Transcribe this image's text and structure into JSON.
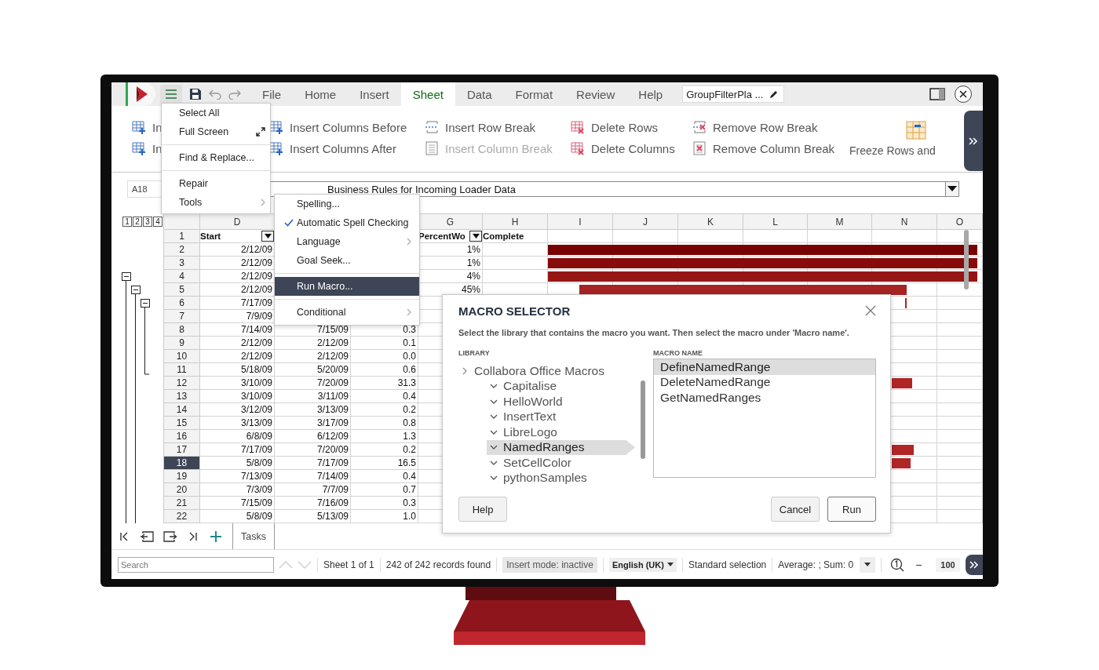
{
  "app": {
    "tabs": [
      {
        "label": "File",
        "selected": false
      },
      {
        "label": "Home",
        "selected": false
      },
      {
        "label": "Insert",
        "selected": false
      },
      {
        "label": "Sheet",
        "selected": true
      },
      {
        "label": "Data",
        "selected": false
      },
      {
        "label": "Format",
        "selected": false
      },
      {
        "label": "Review",
        "selected": false
      },
      {
        "label": "Help",
        "selected": false
      }
    ],
    "document_name": "GroupFilterPla ..."
  },
  "ribbon": {
    "groups": [
      [
        {
          "kind": "rows-above",
          "label": "In",
          "disabled": false
        },
        {
          "kind": "rows-below",
          "label": "In",
          "disabled": false
        }
      ],
      [
        {
          "kind": "cols-before",
          "label": "Insert Columns Before",
          "disabled": false
        },
        {
          "kind": "cols-after",
          "label": "Insert Columns After",
          "disabled": false
        }
      ],
      [
        {
          "kind": "row-break",
          "label": "Insert Row Break",
          "disabled": false
        },
        {
          "kind": "col-break",
          "label": "Insert Column Break",
          "disabled": true
        }
      ],
      [
        {
          "kind": "delete-rows",
          "label": "Delete Rows",
          "disabled": false
        },
        {
          "kind": "delete-cols",
          "label": "Delete Columns",
          "disabled": false
        }
      ],
      [
        {
          "kind": "remove-row-break",
          "label": "Remove Row Break",
          "disabled": false
        },
        {
          "kind": "remove-col-break",
          "label": "Remove Column Break",
          "disabled": false
        }
      ]
    ],
    "large": {
      "label": "Freeze Rows and"
    }
  },
  "formula_bar": {
    "cell": "A18",
    "content": "Business Rules for Incoming Loader Data"
  },
  "sheet": {
    "outline_levels": [
      "1",
      "2",
      "3",
      "4"
    ],
    "columns": [
      {
        "label": "D"
      },
      {},
      {},
      {
        "label": "G"
      },
      {
        "label": "H"
      },
      {
        "label": "I"
      },
      {
        "label": "J"
      },
      {
        "label": "K"
      },
      {
        "label": "L"
      },
      {
        "label": "M"
      },
      {
        "label": "N"
      },
      {
        "label": "O"
      }
    ],
    "header_row": {
      "number": "1",
      "selected": false,
      "cells": [
        {
          "text": "Start",
          "filter": true
        },
        null,
        null,
        {
          "text": "PercentWo",
          "filter": true
        },
        {
          "text": "Complete",
          "filter": false
        }
      ]
    },
    "rows": [
      {
        "number": "2",
        "selected": false,
        "cells": [
          "2/12/09",
          null,
          null,
          "1%",
          null
        ]
      },
      {
        "number": "3",
        "selected": false,
        "cells": [
          "2/12/09",
          null,
          null,
          "1%",
          null
        ]
      },
      {
        "number": "4",
        "selected": false,
        "cells": [
          "2/12/09",
          null,
          null,
          "4%",
          null
        ]
      },
      {
        "number": "5",
        "selected": false,
        "cells": [
          "2/12/09",
          null,
          null,
          "45%",
          null
        ]
      },
      {
        "number": "6",
        "selected": false,
        "cells": [
          "7/17/09",
          null,
          null,
          null,
          null
        ]
      },
      {
        "number": "7",
        "selected": false,
        "cells": [
          "7/9/09",
          null,
          null,
          null,
          null
        ]
      },
      {
        "number": "8",
        "selected": false,
        "cells": [
          "7/14/09",
          "7/15/09",
          "0.3",
          null,
          null
        ]
      },
      {
        "number": "9",
        "selected": false,
        "cells": [
          "2/12/09",
          "2/12/09",
          "0.1",
          null,
          null
        ]
      },
      {
        "number": "10",
        "selected": false,
        "cells": [
          "2/12/09",
          "2/12/09",
          "0.0",
          null,
          null
        ]
      },
      {
        "number": "11",
        "selected": false,
        "cells": [
          "5/18/09",
          "5/20/09",
          "0.6",
          null,
          null
        ]
      },
      {
        "number": "12",
        "selected": false,
        "cells": [
          "3/10/09",
          "7/20/09",
          "31.3",
          null,
          null
        ]
      },
      {
        "number": "13",
        "selected": false,
        "cells": [
          "3/10/09",
          "3/11/09",
          "0.4",
          null,
          null
        ]
      },
      {
        "number": "14",
        "selected": false,
        "cells": [
          "3/12/09",
          "3/13/09",
          "0.2",
          null,
          null
        ]
      },
      {
        "number": "15",
        "selected": false,
        "cells": [
          "3/13/09",
          "3/17/09",
          "0.8",
          null,
          null
        ]
      },
      {
        "number": "16",
        "selected": false,
        "cells": [
          "6/8/09",
          "6/12/09",
          "1.3",
          null,
          null
        ]
      },
      {
        "number": "17",
        "selected": false,
        "cells": [
          "7/17/09",
          "7/20/09",
          "0.2",
          null,
          null
        ]
      },
      {
        "number": "18",
        "selected": true,
        "cells": [
          "5/8/09",
          "7/17/09",
          "16.5",
          null,
          null
        ]
      },
      {
        "number": "19",
        "selected": false,
        "cells": [
          "7/13/09",
          "7/14/09",
          "0.4",
          null,
          null
        ]
      },
      {
        "number": "20",
        "selected": false,
        "cells": [
          "7/3/09",
          "7/7/09",
          "0.7",
          null,
          null
        ]
      },
      {
        "number": "21",
        "selected": false,
        "cells": [
          "7/15/09",
          "7/16/09",
          "0.3",
          null,
          null
        ]
      },
      {
        "number": "22",
        "selected": false,
        "cells": [
          "5/8/09",
          "5/13/09",
          "1.0",
          null,
          null
        ]
      }
    ]
  },
  "sheet_tabs": [
    {
      "label": "Tasks",
      "selected": true
    }
  ],
  "status_bar": {
    "search_placeholder": "Search",
    "sheet": "Sheet 1 of 1",
    "records": "242 of 242 records found",
    "insert_mode": "Insert mode: inactive",
    "language": "English (UK)",
    "selection_mode": "Standard selection",
    "summary": "Average: ; Sum: 0",
    "zoom_out": "−",
    "zoom": "100"
  },
  "main_menu": [
    {
      "kind": "item",
      "label": "Select All"
    },
    {
      "kind": "expand",
      "label": "Full Screen"
    },
    {
      "kind": "separator"
    },
    {
      "kind": "item",
      "label": "Find & Replace..."
    },
    {
      "kind": "separator"
    },
    {
      "kind": "item",
      "label": "Repair"
    },
    {
      "kind": "submenu",
      "label": "Tools"
    }
  ],
  "tools_menu": [
    {
      "kind": "item",
      "label": "Spelling...",
      "checked": false,
      "selected": false
    },
    {
      "kind": "item",
      "label": "Automatic Spell Checking",
      "checked": true,
      "selected": false
    },
    {
      "kind": "submenu",
      "label": "Language",
      "checked": false,
      "selected": false
    },
    {
      "kind": "item",
      "label": "Goal Seek...",
      "checked": false,
      "selected": false
    },
    {
      "kind": "separator"
    },
    {
      "kind": "item",
      "label": "Run Macro...",
      "checked": false,
      "selected": true
    },
    {
      "kind": "separator"
    },
    {
      "kind": "submenu",
      "label": "Conditional",
      "checked": false,
      "selected": false
    }
  ],
  "dialog": {
    "title": "MACRO SELECTOR",
    "description": "Select the library that contains the macro you want. Then select the macro under 'Macro name'.",
    "library_label": "LIBRARY",
    "library_tree": [
      {
        "label": "Collabora Office Macros",
        "expanded": false,
        "selected": false,
        "children": [
          {
            "label": "Capitalise",
            "expanded": true,
            "selected": false
          },
          {
            "label": "HelloWorld",
            "expanded": true,
            "selected": false
          },
          {
            "label": "InsertText",
            "expanded": true,
            "selected": false
          },
          {
            "label": "LibreLogo",
            "expanded": true,
            "selected": false
          },
          {
            "label": "NamedRanges",
            "expanded": true,
            "selected": true
          },
          {
            "label": "SetCellColor",
            "expanded": true,
            "selected": false
          },
          {
            "label": "pythonSamples",
            "expanded": true,
            "selected": false
          }
        ]
      }
    ],
    "macro_label": "MACRO NAME",
    "macros": [
      {
        "label": "DefineNamedRange",
        "selected": true
      },
      {
        "label": "DeleteNamedRange",
        "selected": false
      },
      {
        "label": "GetNamedRanges",
        "selected": false
      }
    ],
    "help_button": "Help",
    "buttons": [
      {
        "label": "Cancel",
        "default": false
      },
      {
        "label": "Run",
        "default": true
      }
    ]
  }
}
